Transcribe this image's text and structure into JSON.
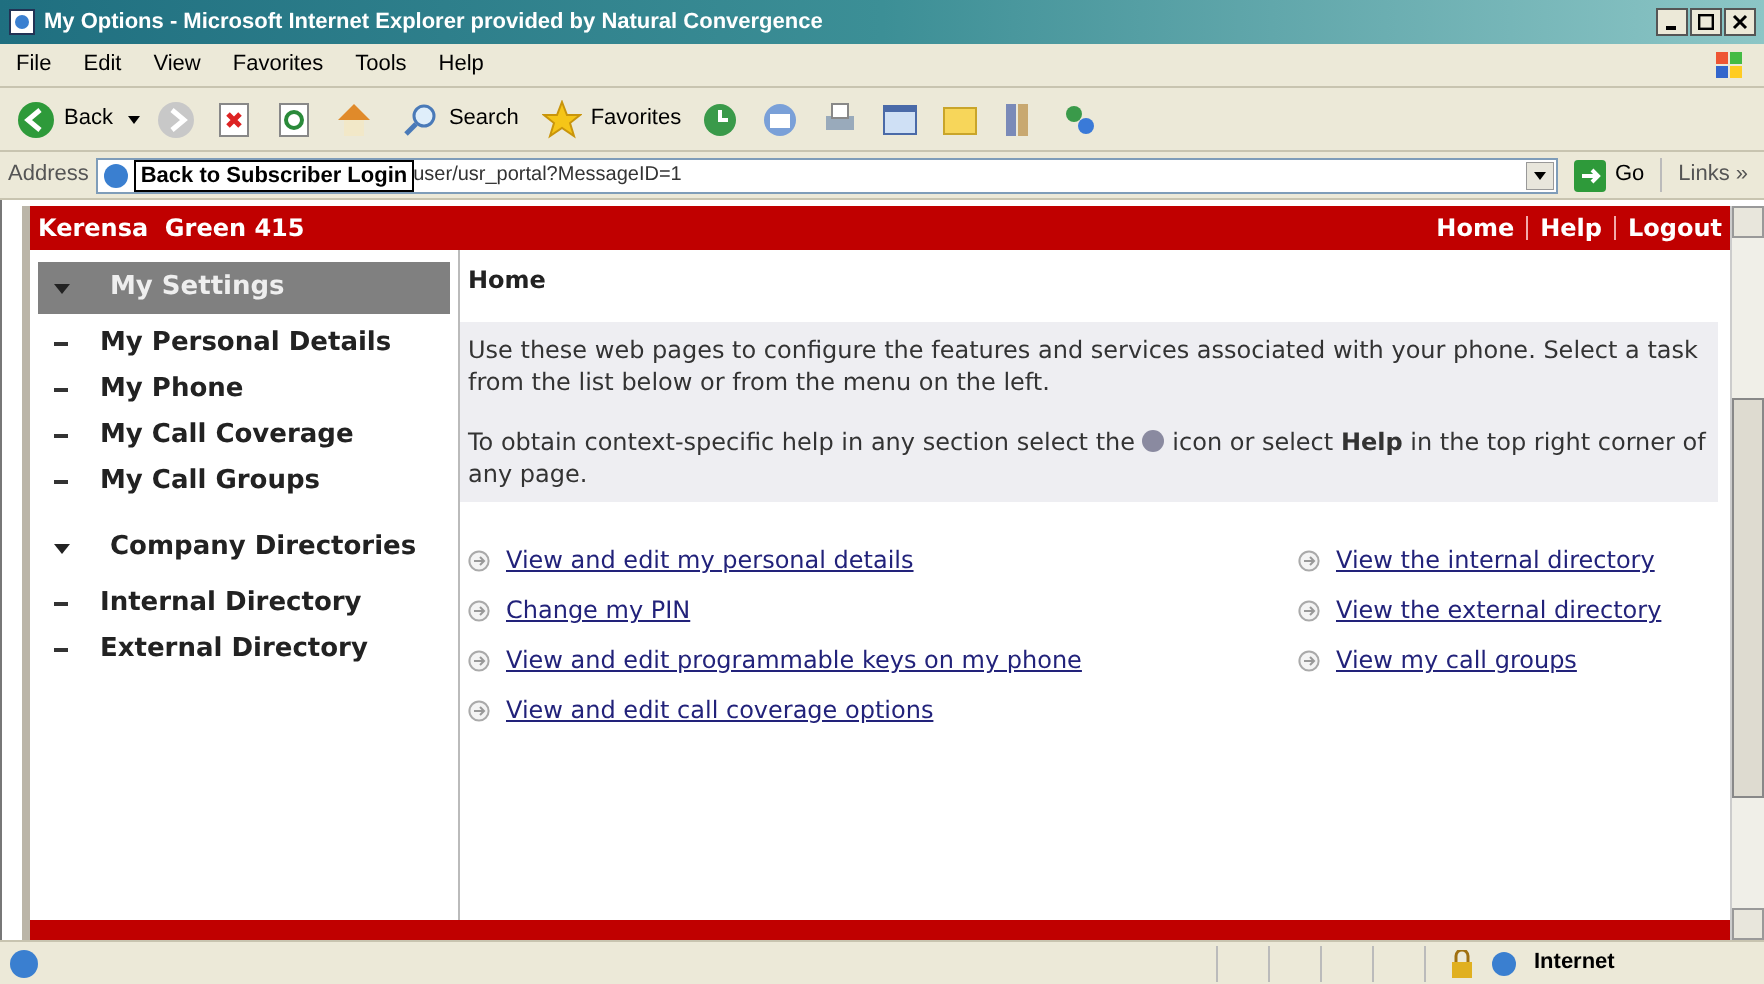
{
  "window": {
    "title": "My Options - Microsoft Internet Explorer provided by Natural Convergence"
  },
  "menu": [
    "File",
    "Edit",
    "View",
    "Favorites",
    "Tools",
    "Help"
  ],
  "toolbar": {
    "back": "Back",
    "search": "Search",
    "favorites": "Favorites"
  },
  "address_bar": {
    "label": "Address",
    "tooltip": "Back to Subscriber Login",
    "url": "user/usr_portal?MessageID=1",
    "go": "Go",
    "links": "Links »"
  },
  "header": {
    "user": "Kerensa  Green 415",
    "links": [
      "Home",
      "Help",
      "Logout"
    ]
  },
  "sidebar": [
    {
      "label": "My Settings",
      "selected": true,
      "expanded": true,
      "children": [
        {
          "label": "My Personal Details"
        },
        {
          "label": "My Phone"
        },
        {
          "label": "My Call Coverage"
        },
        {
          "label": "My Call Groups"
        }
      ]
    },
    {
      "label": "Company Directories",
      "selected": false,
      "expanded": true,
      "children": [
        {
          "label": "Internal Directory"
        },
        {
          "label": "External Directory"
        }
      ]
    }
  ],
  "page": {
    "title": "Home",
    "intro": "Use these web pages to configure the features and services associated with your phone. Select a task from the list below or from the menu on the left.",
    "help_before": "To obtain context-specific help in any section select the",
    "help_after": "icon or select **Help** in the top right corner of any page."
  },
  "links_left": [
    "View and edit my personal details",
    "Change my PIN",
    "View and edit programmable keys on my phone",
    "View and edit call coverage options"
  ],
  "links_right": [
    "View the internal directory",
    "View the external directory",
    "View my call groups"
  ],
  "status_bar": {
    "zone": "Internet"
  }
}
